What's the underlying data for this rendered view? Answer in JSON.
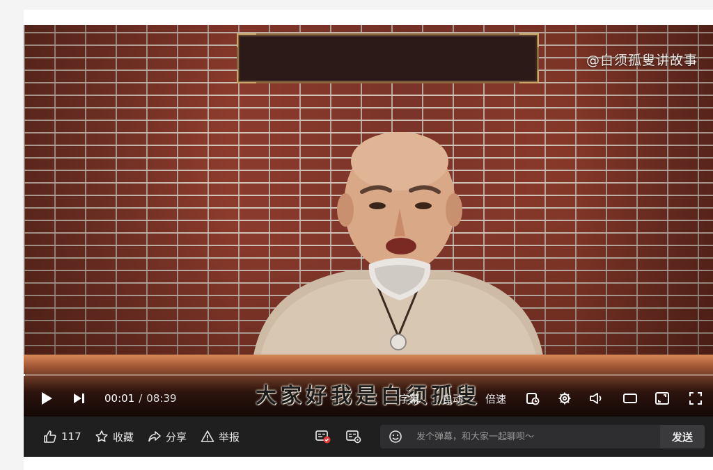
{
  "video": {
    "watermark": "@白须孤叟讲故事",
    "subtitle": "大家好我是白须孤叟",
    "progress_fraction": 0.002
  },
  "controls": {
    "current_time": "00:01",
    "time_separator": "/",
    "duration": "08:39",
    "subtitle_label": "字幕",
    "quality_label": "自动",
    "speed_label": "倍速",
    "icons": [
      "play-icon",
      "next-icon",
      "loop-icon",
      "settings-icon",
      "volume-icon",
      "widescreen-icon",
      "web-fullscreen-icon",
      "fullscreen-icon"
    ]
  },
  "actions": {
    "like_count": "117",
    "favorite_label": "收藏",
    "share_label": "分享",
    "report_label": "举报",
    "danmaku_placeholder": "发个弹幕，和大家一起聊呗～",
    "send_label": "发送"
  },
  "colors": {
    "actionbar_bg": "#1f1f20",
    "input_bg": "#2e2e30",
    "danmaku_toggle_accent": "#e03a3a"
  }
}
